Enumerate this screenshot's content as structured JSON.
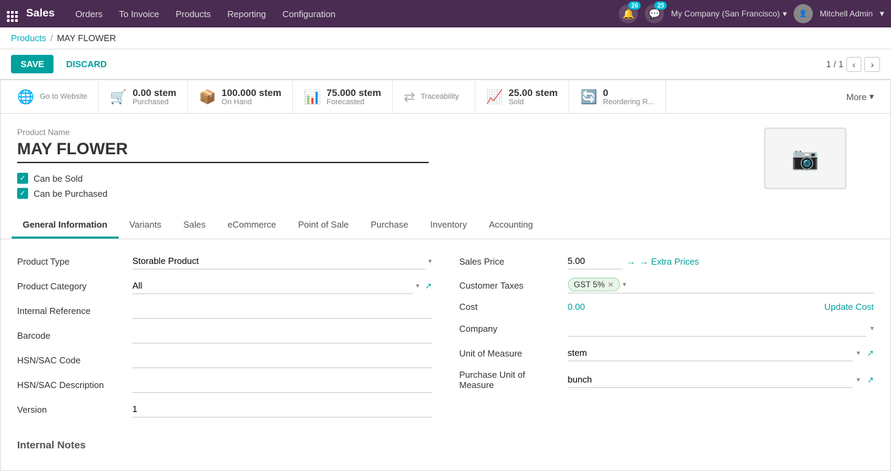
{
  "navbar": {
    "brand": "Sales",
    "links": [
      "Orders",
      "To Invoice",
      "Products",
      "Reporting",
      "Configuration"
    ],
    "notifications_count": 26,
    "messages_count": 25,
    "company": "My Company (San Francisco)",
    "user": "Mitchell Admin"
  },
  "breadcrumb": {
    "parent": "Products",
    "current": "MAY FLOWER"
  },
  "toolbar": {
    "save_label": "SAVE",
    "discard_label": "DISCARD",
    "pagination": "1 / 1"
  },
  "stats": [
    {
      "icon": "🌐",
      "num": "",
      "label": "Go to Website"
    },
    {
      "icon": "🛒",
      "num": "0.00 stem",
      "label": "Purchased"
    },
    {
      "icon": "📦",
      "num": "100.000 stem",
      "label": "On Hand"
    },
    {
      "icon": "📊",
      "num": "75.000 stem",
      "label": "Forecasted"
    },
    {
      "icon": "⇄",
      "num": "",
      "label": "Traceability"
    },
    {
      "icon": "📈",
      "num": "25.00 stem",
      "label": "Sold"
    },
    {
      "icon": "🔄",
      "num": "0",
      "label": "Reordering R..."
    }
  ],
  "more_label": "More",
  "form": {
    "product_name_label": "Product Name",
    "product_name": "MAY FLOWER",
    "can_be_sold": "Can be Sold",
    "can_be_purchased": "Can be Purchased"
  },
  "tabs": [
    {
      "label": "General Information",
      "active": true
    },
    {
      "label": "Variants",
      "active": false
    },
    {
      "label": "Sales",
      "active": false
    },
    {
      "label": "eCommerce",
      "active": false
    },
    {
      "label": "Point of Sale",
      "active": false
    },
    {
      "label": "Purchase",
      "active": false
    },
    {
      "label": "Inventory",
      "active": false
    },
    {
      "label": "Accounting",
      "active": false
    }
  ],
  "fields_left": {
    "product_type_label": "Product Type",
    "product_type_value": "Storable Product",
    "product_category_label": "Product Category",
    "product_category_value": "All",
    "internal_reference_label": "Internal Reference",
    "internal_reference_value": "",
    "barcode_label": "Barcode",
    "barcode_value": "",
    "hsn_sac_code_label": "HSN/SAC Code",
    "hsn_sac_code_value": "",
    "hsn_sac_description_label": "HSN/SAC Description",
    "hsn_sac_description_value": "",
    "version_label": "Version",
    "version_value": "1"
  },
  "fields_right": {
    "sales_price_label": "Sales Price",
    "sales_price_value": "5.00",
    "extra_prices_label": "→ Extra Prices",
    "customer_taxes_label": "Customer Taxes",
    "tax_badge": "GST 5%",
    "cost_label": "Cost",
    "cost_value": "0.00",
    "update_cost_label": "Update Cost",
    "company_label": "Company",
    "company_value": "",
    "unit_of_measure_label": "Unit of Measure",
    "unit_of_measure_value": "stem",
    "purchase_uom_label": "Purchase Unit of Measure",
    "purchase_uom_value": "bunch"
  },
  "internal_notes_title": "Internal Notes"
}
